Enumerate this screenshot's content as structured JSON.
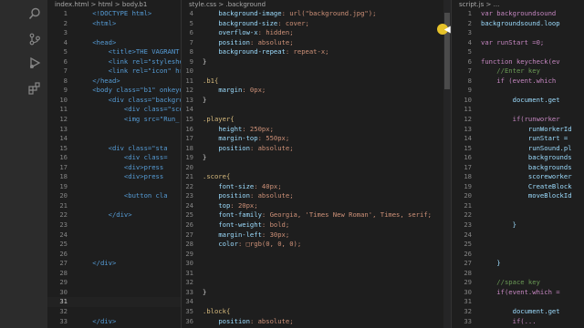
{
  "activity_bar": {
    "icons": [
      "search-icon",
      "source-control-icon",
      "run-debug-icon",
      "extensions-icon"
    ]
  },
  "pane_html": {
    "breadcrumb": "index.html > html > body.b1",
    "lines": [
      {
        "n": "1",
        "t": "    <!DOCTYPE html>"
      },
      {
        "n": "2",
        "t": "    <html>"
      },
      {
        "n": "3",
        "t": ""
      },
      {
        "n": "4",
        "t": "    <head>"
      },
      {
        "n": "5",
        "t": "        <title>THE VAGRANT"
      },
      {
        "n": "6",
        "t": "        <link rel=\"styleshe"
      },
      {
        "n": "7",
        "t": "        <link rel=\"icon\" hr"
      },
      {
        "n": "8",
        "t": "    </head>"
      },
      {
        "n": "9",
        "t": "    <body class=\"b1\" onkeyu"
      },
      {
        "n": "10",
        "t": "        <div class=\"backgro"
      },
      {
        "n": "11",
        "t": "            <div class=\"scor"
      },
      {
        "n": "12",
        "t": "            <img src=\"Run_("
      },
      {
        "n": "13",
        "t": ""
      },
      {
        "n": "14",
        "t": ""
      },
      {
        "n": "15",
        "t": "        <div class=\"sta"
      },
      {
        "n": "16",
        "t": "            <div class="
      },
      {
        "n": "17",
        "t": "            <div>press"
      },
      {
        "n": "18",
        "t": "            <div>press"
      },
      {
        "n": "19",
        "t": ""
      },
      {
        "n": "20",
        "t": "            <button cla"
      },
      {
        "n": "21",
        "t": ""
      },
      {
        "n": "22",
        "t": "        </div>"
      },
      {
        "n": "23",
        "t": ""
      },
      {
        "n": "24",
        "t": ""
      },
      {
        "n": "25",
        "t": ""
      },
      {
        "n": "26",
        "t": ""
      },
      {
        "n": "27",
        "t": "    </div>"
      },
      {
        "n": "28",
        "t": ""
      },
      {
        "n": "29",
        "t": ""
      },
      {
        "n": "30",
        "t": ""
      },
      {
        "n": "31",
        "t": ""
      },
      {
        "n": "32",
        "t": ""
      },
      {
        "n": "33",
        "t": "    </div>"
      }
    ]
  },
  "pane_css": {
    "breadcrumb": "style.css > .background",
    "lines": [
      {
        "n": "4",
        "t": "    background-image: url(\"background.jpg\");"
      },
      {
        "n": "5",
        "t": "    background-size: cover;"
      },
      {
        "n": "6",
        "t": "    overflow-x: hidden;"
      },
      {
        "n": "7",
        "t": "    position: absolute;"
      },
      {
        "n": "8",
        "t": "    background-repeat: repeat-x;"
      },
      {
        "n": "9",
        "t": "}"
      },
      {
        "n": "10",
        "t": ""
      },
      {
        "n": "11",
        "t": ".b1{"
      },
      {
        "n": "12",
        "t": "    margin: 0px;"
      },
      {
        "n": "13",
        "t": "}"
      },
      {
        "n": "14",
        "t": ""
      },
      {
        "n": "15",
        "t": ".player{"
      },
      {
        "n": "16",
        "t": "    height: 250px;"
      },
      {
        "n": "17",
        "t": "    margin-top: 550px;"
      },
      {
        "n": "18",
        "t": "    position: absolute;"
      },
      {
        "n": "19",
        "t": "}"
      },
      {
        "n": "20",
        "t": ""
      },
      {
        "n": "21",
        "t": ".score{"
      },
      {
        "n": "22",
        "t": "    font-size: 40px;"
      },
      {
        "n": "23",
        "t": "    position: absolute;"
      },
      {
        "n": "24",
        "t": "    top: 20px;"
      },
      {
        "n": "25",
        "t": "    font-family: Georgia, 'Times New Roman', Times, serif;"
      },
      {
        "n": "26",
        "t": "    font-weight: bold;"
      },
      {
        "n": "27",
        "t": "    margin-left: 30px;"
      },
      {
        "n": "28",
        "t": "    color: □rgb(0, 0, 0);"
      },
      {
        "n": "29",
        "t": ""
      },
      {
        "n": "30",
        "t": ""
      },
      {
        "n": "31",
        "t": ""
      },
      {
        "n": "32",
        "t": ""
      },
      {
        "n": "33",
        "t": "}"
      },
      {
        "n": "34",
        "t": ""
      },
      {
        "n": "35",
        "t": ".block{"
      },
      {
        "n": "36",
        "t": "    position: absolute;"
      }
    ]
  },
  "pane_js": {
    "breadcrumb": "script.js > ...",
    "lines": [
      {
        "n": "1",
        "t": "var backgroundsound"
      },
      {
        "n": "2",
        "t": "backgroundsound.loop"
      },
      {
        "n": "3",
        "t": ""
      },
      {
        "n": "4",
        "t": "var runStart =0;"
      },
      {
        "n": "5",
        "t": ""
      },
      {
        "n": "6",
        "t": "function keycheck(ev"
      },
      {
        "n": "7",
        "t": "    //Enter key"
      },
      {
        "n": "8",
        "t": "    if (event.which"
      },
      {
        "n": "9",
        "t": ""
      },
      {
        "n": "10",
        "t": "        document.get"
      },
      {
        "n": "11",
        "t": ""
      },
      {
        "n": "12",
        "t": "        if(runworker"
      },
      {
        "n": "13",
        "t": "            runWorkerId"
      },
      {
        "n": "14",
        "t": "            runStart ="
      },
      {
        "n": "15",
        "t": "            runSound.pl"
      },
      {
        "n": "16",
        "t": "            backgrounds"
      },
      {
        "n": "17",
        "t": "            backgrounds"
      },
      {
        "n": "18",
        "t": "            scoreworker"
      },
      {
        "n": "19",
        "t": "            CreateBlock"
      },
      {
        "n": "20",
        "t": "            moveBlockId"
      },
      {
        "n": "21",
        "t": ""
      },
      {
        "n": "22",
        "t": ""
      },
      {
        "n": "23",
        "t": "        }"
      },
      {
        "n": "24",
        "t": ""
      },
      {
        "n": "25",
        "t": ""
      },
      {
        "n": "26",
        "t": ""
      },
      {
        "n": "27",
        "t": "    }"
      },
      {
        "n": "28",
        "t": ""
      },
      {
        "n": "29",
        "t": "    //space key"
      },
      {
        "n": "30",
        "t": "    if(event.which ="
      },
      {
        "n": "31",
        "t": ""
      },
      {
        "n": "32",
        "t": "        document.get"
      },
      {
        "n": "33",
        "t": "        if(..."
      }
    ]
  }
}
